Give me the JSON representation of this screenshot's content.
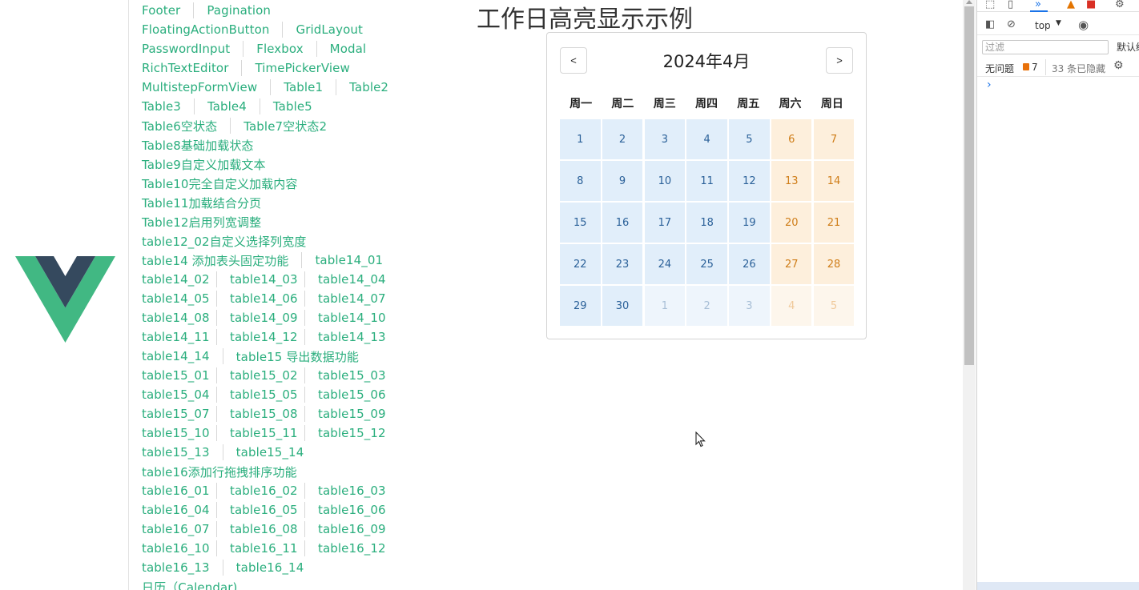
{
  "page": {
    "title": "工作日高亮显示示例"
  },
  "nav": {
    "rows": [
      [
        "Footer",
        "Pagination"
      ],
      [
        "FloatingActionButton",
        "GridLayout"
      ],
      [
        "PasswordInput",
        "Flexbox",
        "Modal"
      ],
      [
        "RichTextEditor",
        "TimePickerView"
      ],
      [
        "MultistepFormView",
        "Table1",
        "Table2"
      ],
      [
        "Table3",
        "Table4",
        "Table5"
      ],
      [
        "Table6空状态",
        "Table7空状态2"
      ],
      [
        "Table8基础加载状态"
      ],
      [
        "Table9自定义加载文本"
      ],
      [
        "Table10完全自定义加载内容"
      ],
      [
        "Table11加载结合分页"
      ],
      [
        "Table12启用列宽调整"
      ],
      [
        "table12_02自定义选择列宽度"
      ],
      [
        "table14 添加表头固定功能",
        "table14_01"
      ],
      [
        "table14_02",
        "table14_03",
        "table14_04"
      ],
      [
        "table14_05",
        "table14_06",
        "table14_07"
      ],
      [
        "table14_08",
        "table14_09",
        "table14_10"
      ],
      [
        "table14_11",
        "table14_12",
        "table14_13"
      ],
      [
        "table14_14",
        "table15 导出数据功能"
      ],
      [
        "table15_01",
        "table15_02",
        "table15_03"
      ],
      [
        "table15_04",
        "table15_05",
        "table15_06"
      ],
      [
        "table15_07",
        "table15_08",
        "table15_09"
      ],
      [
        "table15_10",
        "table15_11",
        "table15_12"
      ],
      [
        "table15_13",
        "table15_14"
      ],
      [
        "table16添加行拖拽排序功能"
      ],
      [
        "table16_01",
        "table16_02",
        "table16_03"
      ],
      [
        "table16_04",
        "table16_05",
        "table16_06"
      ],
      [
        "table16_07",
        "table16_08",
        "table16_09"
      ],
      [
        "table16_10",
        "table16_11",
        "table16_12"
      ],
      [
        "table16_13",
        "table16_14"
      ],
      [
        "日历（Calendar)"
      ]
    ]
  },
  "calendar": {
    "prev_label": "<",
    "next_label": ">",
    "month_title": "2024年4月",
    "weekdays": [
      "周一",
      "周二",
      "周三",
      "周四",
      "周五",
      "周六",
      "周日"
    ],
    "days": [
      {
        "label": "1",
        "kind": "work"
      },
      {
        "label": "2",
        "kind": "work"
      },
      {
        "label": "3",
        "kind": "work"
      },
      {
        "label": "4",
        "kind": "work"
      },
      {
        "label": "5",
        "kind": "work"
      },
      {
        "label": "6",
        "kind": "weekend"
      },
      {
        "label": "7",
        "kind": "weekend"
      },
      {
        "label": "8",
        "kind": "work"
      },
      {
        "label": "9",
        "kind": "work"
      },
      {
        "label": "10",
        "kind": "work"
      },
      {
        "label": "11",
        "kind": "work"
      },
      {
        "label": "12",
        "kind": "work"
      },
      {
        "label": "13",
        "kind": "weekend"
      },
      {
        "label": "14",
        "kind": "weekend"
      },
      {
        "label": "15",
        "kind": "work"
      },
      {
        "label": "16",
        "kind": "work"
      },
      {
        "label": "17",
        "kind": "work"
      },
      {
        "label": "18",
        "kind": "work"
      },
      {
        "label": "19",
        "kind": "work"
      },
      {
        "label": "20",
        "kind": "weekend"
      },
      {
        "label": "21",
        "kind": "weekend"
      },
      {
        "label": "22",
        "kind": "work"
      },
      {
        "label": "23",
        "kind": "work"
      },
      {
        "label": "24",
        "kind": "work"
      },
      {
        "label": "25",
        "kind": "work"
      },
      {
        "label": "26",
        "kind": "work"
      },
      {
        "label": "27",
        "kind": "weekend"
      },
      {
        "label": "28",
        "kind": "weekend"
      },
      {
        "label": "29",
        "kind": "work"
      },
      {
        "label": "30",
        "kind": "work"
      },
      {
        "label": "1",
        "kind": "work other"
      },
      {
        "label": "2",
        "kind": "work other"
      },
      {
        "label": "3",
        "kind": "work other"
      },
      {
        "label": "4",
        "kind": "weekend other"
      },
      {
        "label": "5",
        "kind": "weekend other"
      }
    ]
  },
  "devtools": {
    "context": "top",
    "filter_placeholder": "过滤",
    "levels_label": "默认级",
    "issues_label": "无问题",
    "issues_count": "7",
    "hidden_label": "33 条已隐藏",
    "prompt": "›"
  },
  "colors": {
    "link": "#2aae7d",
    "workday_bg": "#e1eefa",
    "weekend_bg": "#fdefdc"
  }
}
